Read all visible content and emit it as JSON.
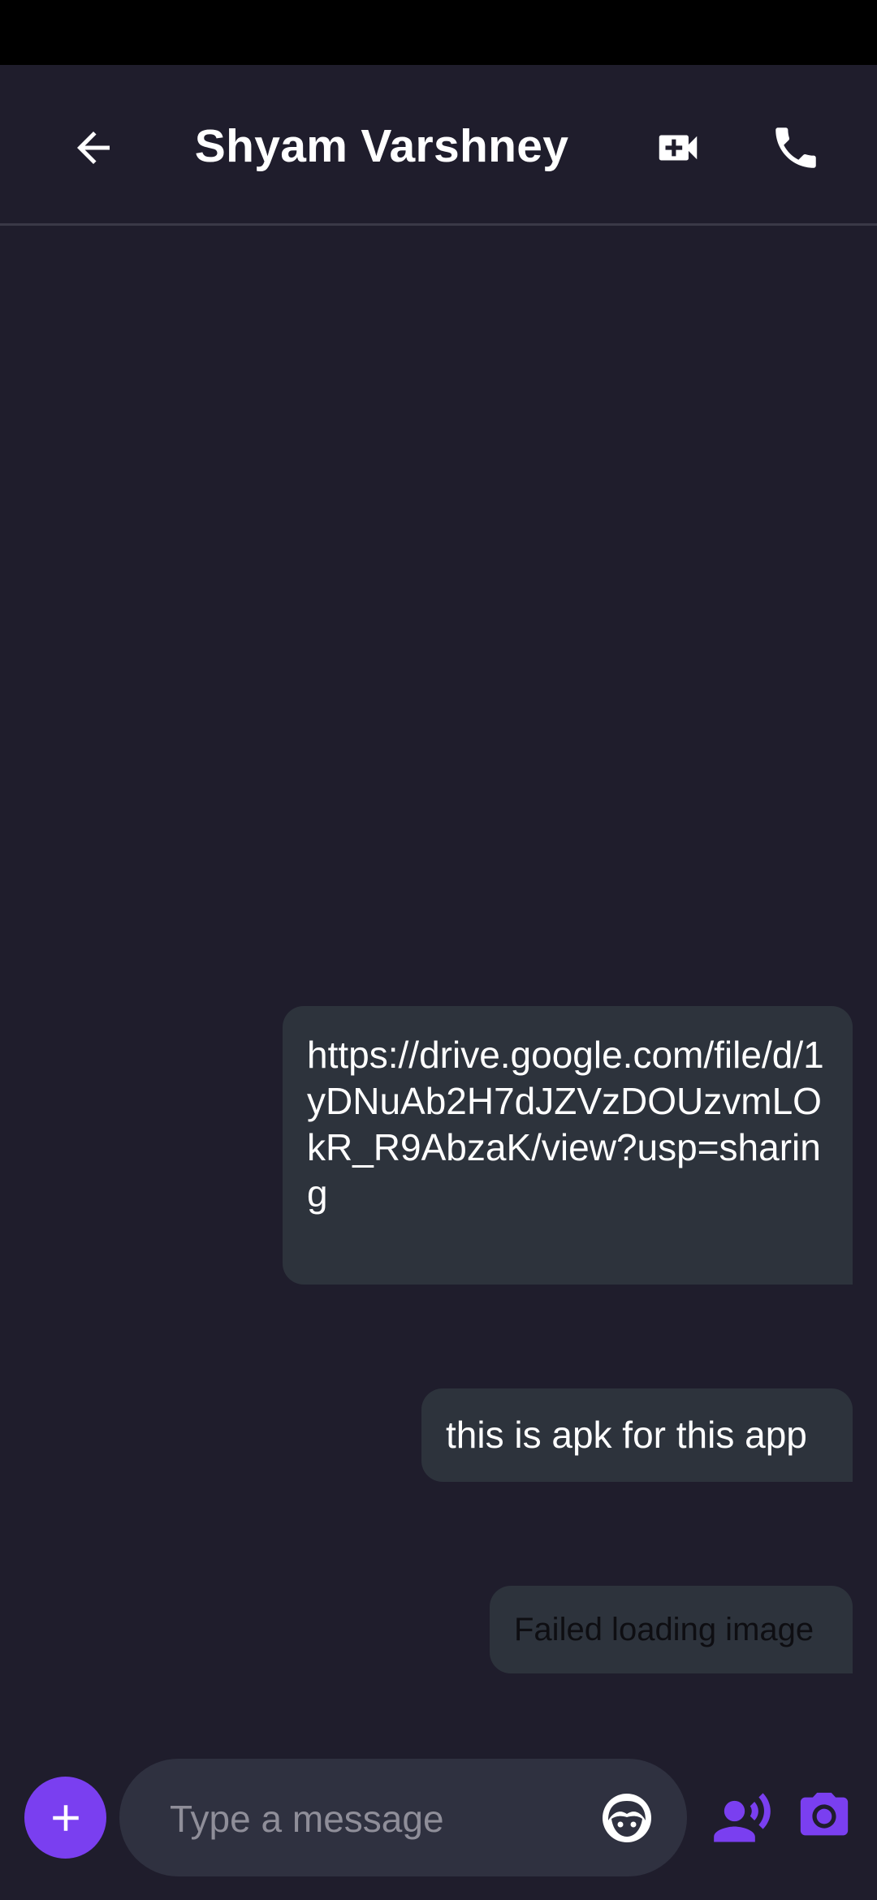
{
  "header": {
    "title": "Shyam Varshney",
    "back_icon": "arrow-back-icon",
    "video_icon": "video-call-icon",
    "call_icon": "phone-call-icon"
  },
  "messages": [
    {
      "type": "text",
      "text": "https://drive.google.com/file/d/1yDNuAb2H7dJZVzDOUzvmLOkR_R9AbzaK/view?usp=sharing"
    },
    {
      "type": "text",
      "text": "this is apk for this app"
    },
    {
      "type": "image-error",
      "text": "Failed loading image"
    }
  ],
  "composer": {
    "placeholder": "Type a message",
    "value": "",
    "plus_icon": "plus-icon",
    "emoji_icon": "emoji-face-icon",
    "voice_icon": "voice-speaker-icon",
    "camera_icon": "camera-icon"
  },
  "colors": {
    "background": "#1f1d2c",
    "bubble": "#2d333c",
    "accent": "#7a3ff0",
    "input_bg": "#2f3140"
  }
}
